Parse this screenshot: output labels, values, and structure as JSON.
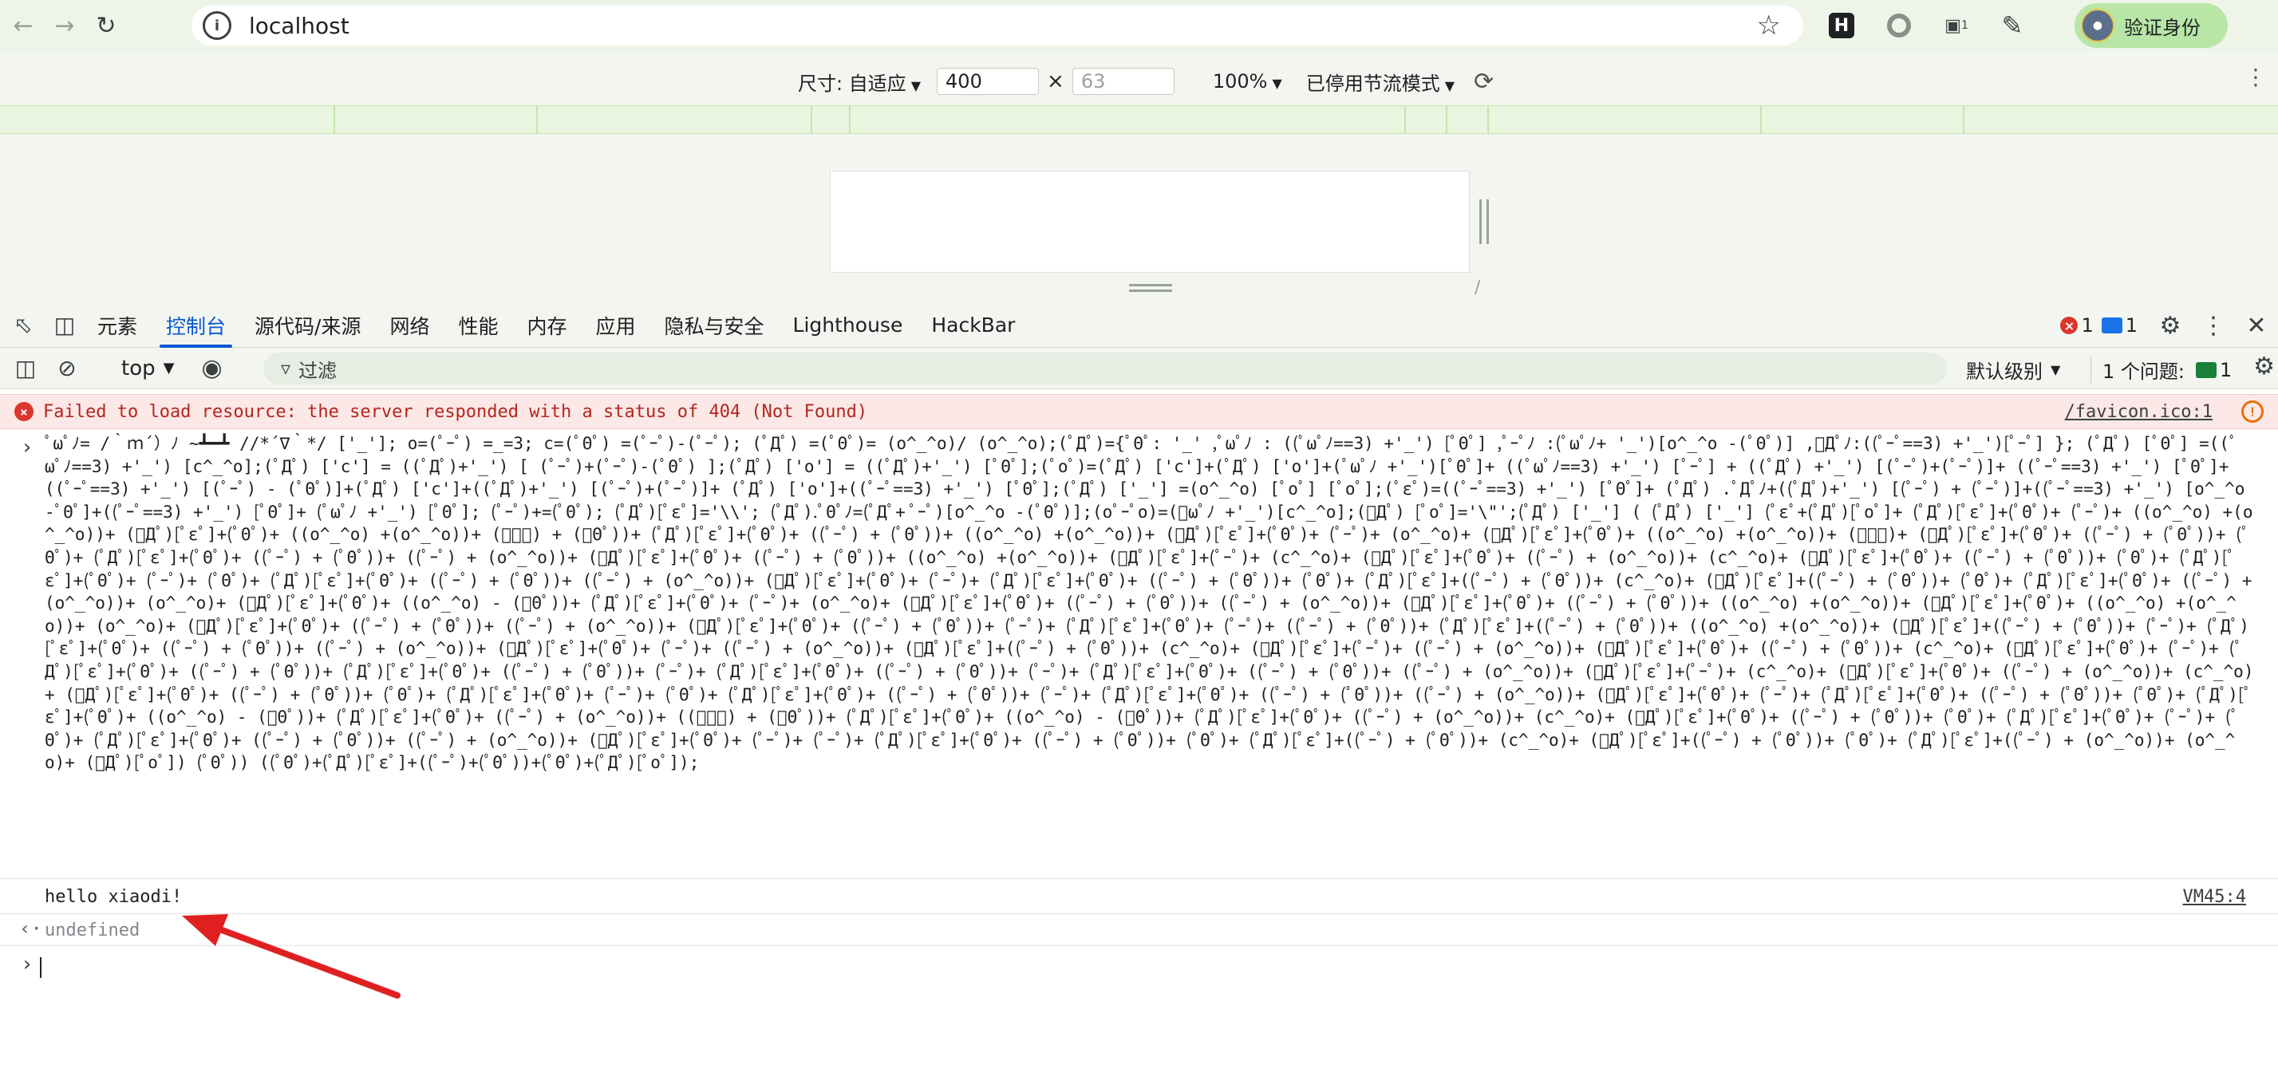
{
  "browser": {
    "url": "localhost",
    "profile_button": "验证身份",
    "extension_h_label": "H",
    "extension_badge_count": "1"
  },
  "device_toolbar": {
    "size_label": "尺寸: 自适应",
    "width_value": "400",
    "times": "×",
    "height_placeholder": "63",
    "zoom": "100%",
    "throttle": "已停用节流模式"
  },
  "devtools": {
    "tabs": [
      "元素",
      "控制台",
      "源代码/来源",
      "网络",
      "性能",
      "内存",
      "应用",
      "隐私与安全",
      "Lighthouse",
      "HackBar"
    ],
    "active_tab": "控制台",
    "error_count": "1",
    "message_count": "1"
  },
  "console_toolbar": {
    "context": "top",
    "filter_placeholder": "过滤",
    "level": "默认级别",
    "issues_label": "1 个问题:",
    "issues_count": "1"
  },
  "console": {
    "error_message": "Failed to load resource: the server responded with a status of 404 (Not Found)",
    "error_source": "/favicon.ico:1",
    "code_input": "ﾟωﾟﾉ= /｀ｍ´）ﾉ ~┻━┻   //*´∇｀*/ ['_']; o=(ﾟｰﾟ)  =_=3; c=(ﾟΘﾟ) =(ﾟｰﾟ)-(ﾟｰﾟ); (ﾟДﾟ) =(ﾟΘﾟ)= (o^_^o)/ (o^_^o);(ﾟДﾟ)={ﾟΘﾟ: '_' ,ﾟωﾟﾉ : ((ﾟωﾟﾉ==3) +'_') [ﾟΘﾟ] ,ﾟｰﾟﾉ :(ﾟωﾟﾉ+ '_')[o^_^o -(ﾟΘﾟ)] ,ﾟДﾟﾉ:((ﾟｰﾟ==3) +'_')[ﾟｰﾟ] }; (ﾟДﾟ) [ﾟΘﾟ] =((ﾟωﾟﾉ==3) +'_') [c^_^o];(ﾟДﾟ) ['c'] = ((ﾟДﾟ)+'_') [ (ﾟｰﾟ)+(ﾟｰﾟ)-(ﾟΘﾟ) ];(ﾟДﾟ) ['o'] = ((ﾟДﾟ)+'_') [ﾟΘﾟ];(ﾟoﾟ)=(ﾟДﾟ) ['c']+(ﾟДﾟ) ['o']+(ﾟωﾟﾉ +'_')[ﾟΘﾟ]+ ((ﾟωﾟﾉ==3) +'_') [ﾟｰﾟ] + ((ﾟДﾟ) +'_') [(ﾟｰﾟ)+(ﾟｰﾟ)]+ ((ﾟｰﾟ==3) +'_') [ﾟΘﾟ]+((ﾟｰﾟ==3) +'_') [(ﾟｰﾟ) - (ﾟΘﾟ)]+(ﾟДﾟ) ['c']+((ﾟДﾟ)+'_') [(ﾟｰﾟ)+(ﾟｰﾟ)]+ (ﾟДﾟ) ['o']+((ﾟｰﾟ==3) +'_') [ﾟΘﾟ];(ﾟДﾟ) ['_'] =(o^_^o) [ﾟoﾟ] [ﾟoﾟ];(ﾟεﾟ)=((ﾟｰﾟ==3) +'_') [ﾟΘﾟ]+ (ﾟДﾟ) .ﾟДﾟﾉ+((ﾟДﾟ)+'_') [(ﾟｰﾟ) + (ﾟｰﾟ)]+((ﾟｰﾟ==3) +'_') [o^_^o -ﾟΘﾟ]+((ﾟｰﾟ==3) +'_') [ﾟΘﾟ]+ (ﾟωﾟﾉ +'_') [ﾟΘﾟ]; (ﾟｰﾟ)+=(ﾟΘﾟ); (ﾟДﾟ)[ﾟεﾟ]='\\\\'; (ﾟДﾟ).ﾟΘﾟﾉ=(ﾟДﾟ+ ﾟｰﾟ)[o^_^o -(ﾟΘﾟ)];(oﾟｰﾟo)=(ﾟωﾟﾉ +'_')[c^_^o];(ﾟДﾟ) [ﾟoﾟ]='\\\"';(ﾟДﾟ) ['_'] ( (ﾟДﾟ) ['_'] (ﾟεﾟ+(ﾟДﾟ)[ﾟoﾟ]+ (ﾟДﾟ)[ﾟεﾟ]+(ﾟΘﾟ)+ (ﾟｰﾟ)+ ((o^_^o) +(o^_^o))+ (ﾟДﾟ)[ﾟεﾟ]+(ﾟΘﾟ)+ ((o^_^o) +(o^_^o))+ (ﾟｰﾟ) + (ﾟΘﾟ))+ (ﾟДﾟ)[ﾟεﾟ]+(ﾟΘﾟ)+ ((ﾟｰﾟ) + (ﾟΘﾟ))+ ((o^_^o) +(o^_^o))+ (ﾟДﾟ)[ﾟεﾟ]+(ﾟΘﾟ)+ (ﾟｰﾟ)+ (o^_^o)+ (ﾟДﾟ)[ﾟεﾟ]+(ﾟΘﾟ)+ ((o^_^o) +(o^_^o))+ (ﾟｰﾟ)+ (ﾟДﾟ)[ﾟεﾟ]+(ﾟΘﾟ)+ ((ﾟｰﾟ) + (ﾟΘﾟ))+ (ﾟΘﾟ)+ (ﾟДﾟ)[ﾟεﾟ]+(ﾟΘﾟ)+ ((ﾟｰﾟ) + (ﾟΘﾟ))+ ((ﾟｰﾟ) + (o^_^o))+ (ﾟДﾟ)[ﾟεﾟ]+(ﾟΘﾟ)+ ((ﾟｰﾟ) + (ﾟΘﾟ))+ ((o^_^o) +(o^_^o))+ (ﾟДﾟ)[ﾟεﾟ]+(ﾟｰﾟ)+ (c^_^o)+ (ﾟДﾟ)[ﾟεﾟ]+(ﾟΘﾟ)+ ((ﾟｰﾟ) + (o^_^o))+ (c^_^o)+ (ﾟДﾟ)[ﾟεﾟ]+(ﾟΘﾟ)+ ((ﾟｰﾟ) + (ﾟΘﾟ))+ (ﾟΘﾟ)+ (ﾟДﾟ)[ﾟεﾟ]+(ﾟΘﾟ)+ (ﾟｰﾟ)+ (ﾟΘﾟ)+ (ﾟДﾟ)[ﾟεﾟ]+(ﾟΘﾟ)+ ((ﾟｰﾟ) + (ﾟΘﾟ))+ ((ﾟｰﾟ) + (o^_^o))+ (ﾟДﾟ)[ﾟεﾟ]+(ﾟΘﾟ)+ (ﾟｰﾟ)+ (ﾟДﾟ)[ﾟεﾟ]+(ﾟΘﾟ)+ ((ﾟｰﾟ) + (ﾟΘﾟ))+ (ﾟΘﾟ)+ (ﾟДﾟ)[ﾟεﾟ]+((ﾟｰﾟ) + (ﾟΘﾟ))+ (c^_^o)+ (ﾟДﾟ)[ﾟεﾟ]+((ﾟｰﾟ) + (ﾟΘﾟ))+ (ﾟΘﾟ)+ (ﾟДﾟ)[ﾟεﾟ]+(ﾟΘﾟ)+ ((ﾟｰﾟ) + (o^_^o))+ (o^_^o)+ (ﾟДﾟ)[ﾟεﾟ]+(ﾟΘﾟ)+ ((o^_^o) - (ﾟΘﾟ))+ (ﾟДﾟ)[ﾟεﾟ]+(ﾟΘﾟ)+ (ﾟｰﾟ)+ (o^_^o)+ (ﾟДﾟ)[ﾟεﾟ]+(ﾟΘﾟ)+ ((ﾟｰﾟ) + (ﾟΘﾟ))+ ((ﾟｰﾟ) + (o^_^o))+ (ﾟДﾟ)[ﾟεﾟ]+(ﾟΘﾟ)+ ((ﾟｰﾟ) + (ﾟΘﾟ))+ ((o^_^o) +(o^_^o))+ (ﾟДﾟ)[ﾟεﾟ]+(ﾟΘﾟ)+ ((o^_^o) +(o^_^o))+ (o^_^o)+ (ﾟДﾟ)[ﾟεﾟ]+(ﾟΘﾟ)+ ((ﾟｰﾟ) + (ﾟΘﾟ))+ ((ﾟｰﾟ) + (o^_^o))+ (ﾟДﾟ)[ﾟεﾟ]+(ﾟΘﾟ)+ ((ﾟｰﾟ) + (ﾟΘﾟ))+ (ﾟｰﾟ)+ (ﾟДﾟ)[ﾟεﾟ]+(ﾟΘﾟ)+ (ﾟｰﾟ)+ ((ﾟｰﾟ) + (ﾟΘﾟ))+ (ﾟДﾟ)[ﾟεﾟ]+((ﾟｰﾟ) + (ﾟΘﾟ))+ ((o^_^o) +(o^_^o))+ (ﾟДﾟ)[ﾟεﾟ]+((ﾟｰﾟ) + (ﾟΘﾟ))+ (ﾟｰﾟ)+ (ﾟДﾟ)[ﾟεﾟ]+(ﾟΘﾟ)+ ((ﾟｰﾟ) + (ﾟΘﾟ))+ ((ﾟｰﾟ) + (o^_^o))+ (ﾟДﾟ)[ﾟεﾟ]+(ﾟΘﾟ)+ (ﾟｰﾟ)+ ((ﾟｰﾟ) + (o^_^o))+ (ﾟДﾟ)[ﾟεﾟ]+((ﾟｰﾟ) + (ﾟΘﾟ))+ (c^_^o)+ (ﾟДﾟ)[ﾟεﾟ]+(ﾟｰﾟ)+ ((ﾟｰﾟ) + (o^_^o))+ (ﾟДﾟ)[ﾟεﾟ]+(ﾟΘﾟ)+ ((ﾟｰﾟ) + (ﾟΘﾟ))+ (c^_^o)+ (ﾟДﾟ)[ﾟεﾟ]+(ﾟΘﾟ)+ (ﾟｰﾟ)+ (ﾟДﾟ)[ﾟεﾟ]+(ﾟΘﾟ)+ ((ﾟｰﾟ) + (ﾟΘﾟ))+ (ﾟДﾟ)[ﾟεﾟ]+(ﾟΘﾟ)+ ((ﾟｰﾟ) + (ﾟΘﾟ))+ (ﾟｰﾟ)+ (ﾟДﾟ)[ﾟεﾟ]+(ﾟΘﾟ)+ ((ﾟｰﾟ) + (ﾟΘﾟ))+ (ﾟｰﾟ)+ (ﾟДﾟ)[ﾟεﾟ]+(ﾟΘﾟ)+ ((ﾟｰﾟ) + (ﾟΘﾟ))+ ((ﾟｰﾟ) + (o^_^o))+ (ﾟДﾟ)[ﾟεﾟ]+(ﾟｰﾟ)+ (c^_^o)+ (ﾟДﾟ)[ﾟεﾟ]+(ﾟΘﾟ)+ ((ﾟｰﾟ) + (o^_^o))+ (c^_^o)+ (ﾟДﾟ)[ﾟεﾟ]+(ﾟΘﾟ)+ ((ﾟｰﾟ) + (ﾟΘﾟ))+ (ﾟΘﾟ)+ (ﾟДﾟ)[ﾟεﾟ]+(ﾟΘﾟ)+ (ﾟｰﾟ)+ (ﾟΘﾟ)+ (ﾟДﾟ)[ﾟεﾟ]+(ﾟΘﾟ)+ ((ﾟｰﾟ) + (ﾟΘﾟ))+ (ﾟｰﾟ)+ (ﾟДﾟ)[ﾟεﾟ]+(ﾟΘﾟ)+ ((ﾟｰﾟ) + (ﾟΘﾟ))+ ((ﾟｰﾟ) + (o^_^o))+ (ﾟДﾟ)[ﾟεﾟ]+(ﾟΘﾟ)+ (ﾟｰﾟ)+ (ﾟДﾟ)[ﾟεﾟ]+(ﾟΘﾟ)+ ((ﾟｰﾟ) + (ﾟΘﾟ))+ (ﾟΘﾟ)+ (ﾟДﾟ)[ﾟεﾟ]+(ﾟΘﾟ)+ ((o^_^o) - (ﾟΘﾟ))+ (ﾟДﾟ)[ﾟεﾟ]+(ﾟΘﾟ)+ ((ﾟｰﾟ) + (o^_^o))+ ((ﾟｰﾟ) + (ﾟΘﾟ))+ (ﾟДﾟ)[ﾟεﾟ]+(ﾟΘﾟ)+ ((o^_^o) - (ﾟΘﾟ))+ (ﾟДﾟ)[ﾟεﾟ]+(ﾟΘﾟ)+ ((ﾟｰﾟ) + (o^_^o))+ (c^_^o)+ (ﾟДﾟ)[ﾟεﾟ]+(ﾟΘﾟ)+ ((ﾟｰﾟ) + (ﾟΘﾟ))+ (ﾟΘﾟ)+ (ﾟДﾟ)[ﾟεﾟ]+(ﾟΘﾟ)+ (ﾟｰﾟ)+ (ﾟΘﾟ)+ (ﾟДﾟ)[ﾟεﾟ]+(ﾟΘﾟ)+ ((ﾟｰﾟ) + (ﾟΘﾟ))+ ((ﾟｰﾟ) + (o^_^o))+ (ﾟДﾟ)[ﾟεﾟ]+(ﾟΘﾟ)+ (ﾟｰﾟ)+ (ﾟｰﾟ)+ (ﾟДﾟ)[ﾟεﾟ]+(ﾟΘﾟ)+ ((ﾟｰﾟ) + (ﾟΘﾟ))+ (ﾟΘﾟ)+ (ﾟДﾟ)[ﾟεﾟ]+((ﾟｰﾟ) + (ﾟΘﾟ))+ (c^_^o)+ (ﾟДﾟ)[ﾟεﾟ]+((ﾟｰﾟ) + (ﾟΘﾟ))+ (ﾟΘﾟ)+ (ﾟДﾟ)[ﾟεﾟ]+((ﾟｰﾟ) + (o^_^o))+ (o^_^o)+ (ﾟДﾟ)[ﾟoﾟ]) (ﾟΘﾟ)) ((ﾟΘﾟ)+(ﾟДﾟ)[ﾟεﾟ]+((ﾟｰﾟ)+(ﾟΘﾟ))+(ﾟΘﾟ)+(ﾟДﾟ)[ﾟoﾟ]);",
    "output_text": "hello xiaodi!",
    "output_source": "VM45:4",
    "return_value": "undefined"
  },
  "annotation": {
    "arrow_color": "#e02020"
  }
}
